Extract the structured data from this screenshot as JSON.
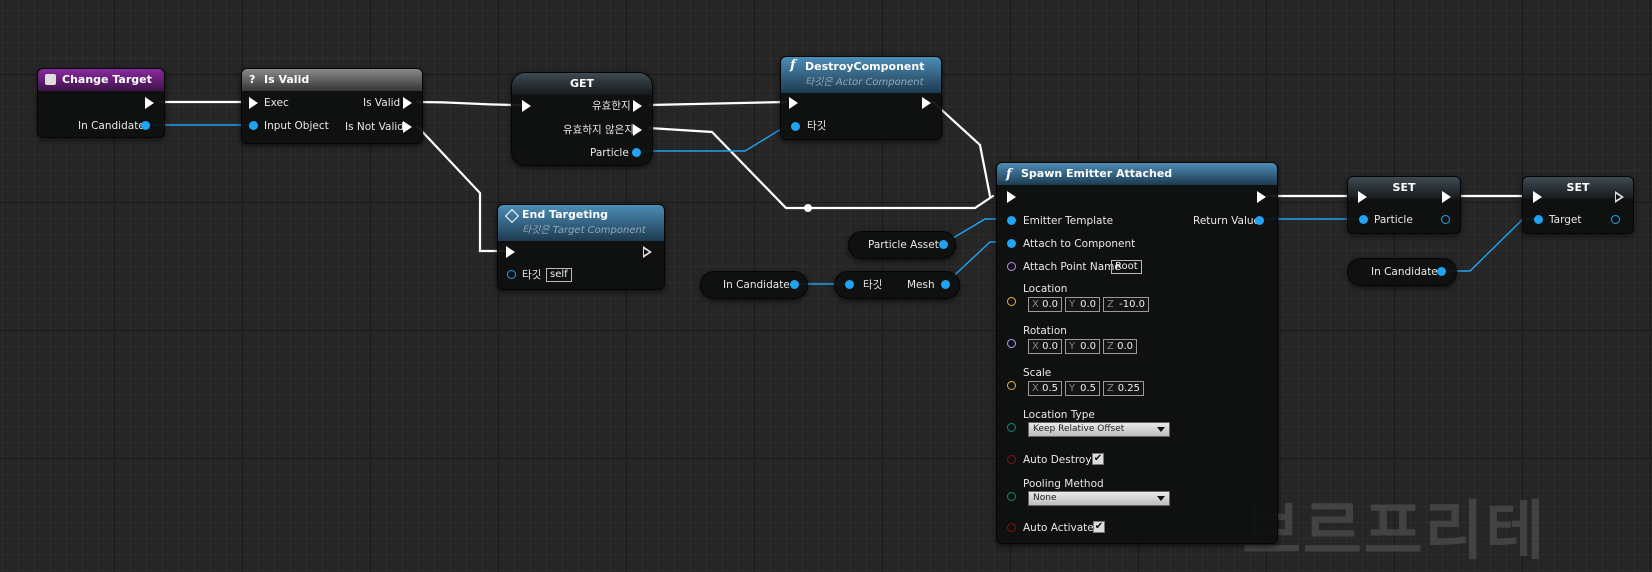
{
  "nodes": {
    "change_target": {
      "title": "Change Target",
      "pin_in_candidate": "In Candidate"
    },
    "is_valid": {
      "title": "Is Valid",
      "exec": "Exec",
      "input_object": "Input Object",
      "is_valid": "Is Valid",
      "is_not_valid": "Is Not Valid"
    },
    "get": {
      "title": "GET",
      "valid": "유효한지",
      "not_valid": "유효하지 않은지",
      "particle": "Particle"
    },
    "destroy": {
      "title": "DestroyComponent",
      "subtitle": "타깃은 Actor Component",
      "target": "타깃"
    },
    "end_targeting": {
      "title": "End Targeting",
      "subtitle": "타깃은 Target Component",
      "target": "타깃",
      "self": "self"
    },
    "particle_asset": {
      "label": "Particle Asset"
    },
    "in_candidate_mid": {
      "label": "In Candidate"
    },
    "mesh_get": {
      "target": "타깃",
      "mesh": "Mesh"
    },
    "spawn": {
      "title": "Spawn Emitter Attached",
      "emitter_template": "Emitter Template",
      "return_value": "Return Value",
      "attach_to_component": "Attach to Component",
      "attach_point_name": "Attach Point Name",
      "attach_point_value": "Root",
      "location": "Location",
      "location_x": "0.0",
      "location_y": "0.0",
      "location_z": "-10.0",
      "rotation": "Rotation",
      "rotation_x": "0.0",
      "rotation_y": "0.0",
      "rotation_z": "0.0",
      "scale": "Scale",
      "scale_x": "0.5",
      "scale_y": "0.5",
      "scale_z": "0.25",
      "axis_x": "X",
      "axis_y": "Y",
      "axis_z": "Z",
      "location_type": "Location Type",
      "location_type_value": "Keep Relative Offset",
      "auto_destroy": "Auto Destroy",
      "auto_destroy_checked": "✔",
      "pooling_method": "Pooling Method",
      "pooling_method_value": "None",
      "auto_activate": "Auto Activate",
      "auto_activate_checked": "✔"
    },
    "set1": {
      "title": "SET",
      "particle": "Particle"
    },
    "set2": {
      "title": "SET",
      "target": "Target"
    },
    "in_candidate_right": {
      "label": "In Candidate"
    }
  },
  "watermark": "브르프리테",
  "colors": {
    "exec": "#ffffff",
    "object_pin": "#1fa3f2",
    "struct_pin": "#e7b23c",
    "rotator_pin": "#9aa6ff",
    "name_pin": "#c18af7",
    "byte_pin": "#0f8a74",
    "bool_pin": "#8a1010",
    "event_header": "#8a2aa0",
    "function_header": "#4d8db6"
  }
}
